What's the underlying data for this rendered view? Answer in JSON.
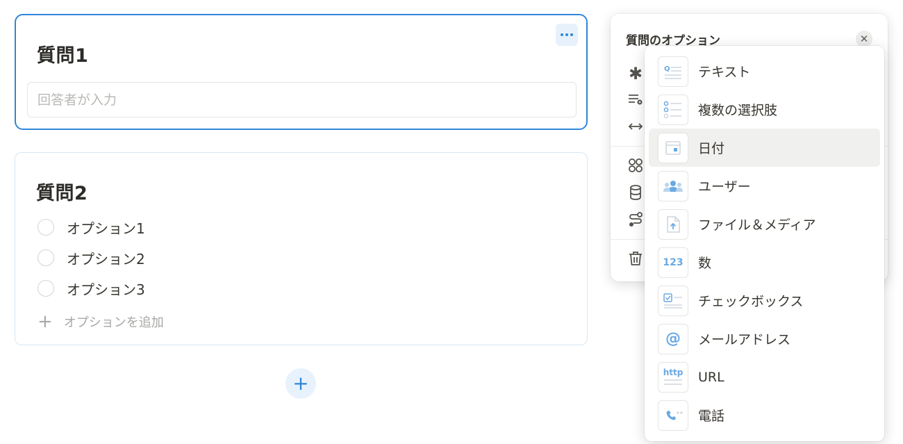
{
  "question1": {
    "title": "質問1",
    "answer_placeholder": "回答者が入力",
    "more_label": "•••"
  },
  "question2": {
    "title": "質問2",
    "options": [
      "オプション1",
      "オプション2",
      "オプション3"
    ],
    "add_option_label": "オプションを追加"
  },
  "add_question_label": "+",
  "options_panel": {
    "title": "質問のオプション",
    "close_label": "✕",
    "side_icons": [
      "asterisk-icon",
      "description-icon",
      "width-icon",
      "group-icon",
      "database-icon",
      "logic-icon",
      "trash-icon"
    ]
  },
  "type_menu": {
    "items": [
      {
        "icon": "text-icon",
        "label": "テキスト"
      },
      {
        "icon": "multiple-choice-icon",
        "label": "複数の選択肢"
      },
      {
        "icon": "date-icon",
        "label": "日付"
      },
      {
        "icon": "user-icon",
        "label": "ユーザー"
      },
      {
        "icon": "file-upload-icon",
        "label": "ファイル＆メディア"
      },
      {
        "icon": "number-icon",
        "label": "数",
        "icon_text": "123"
      },
      {
        "icon": "checkbox-icon",
        "label": "チェックボックス"
      },
      {
        "icon": "email-icon",
        "label": "メールアドレス",
        "icon_text": "@"
      },
      {
        "icon": "url-icon",
        "label": "URL",
        "icon_text": "http"
      },
      {
        "icon": "phone-icon",
        "label": "電話"
      }
    ],
    "highlighted_index": 2
  },
  "colors": {
    "accent": "#2f86d8",
    "icon_blue": "#6aa9e3",
    "hover_bg": "#f0f0ef"
  }
}
